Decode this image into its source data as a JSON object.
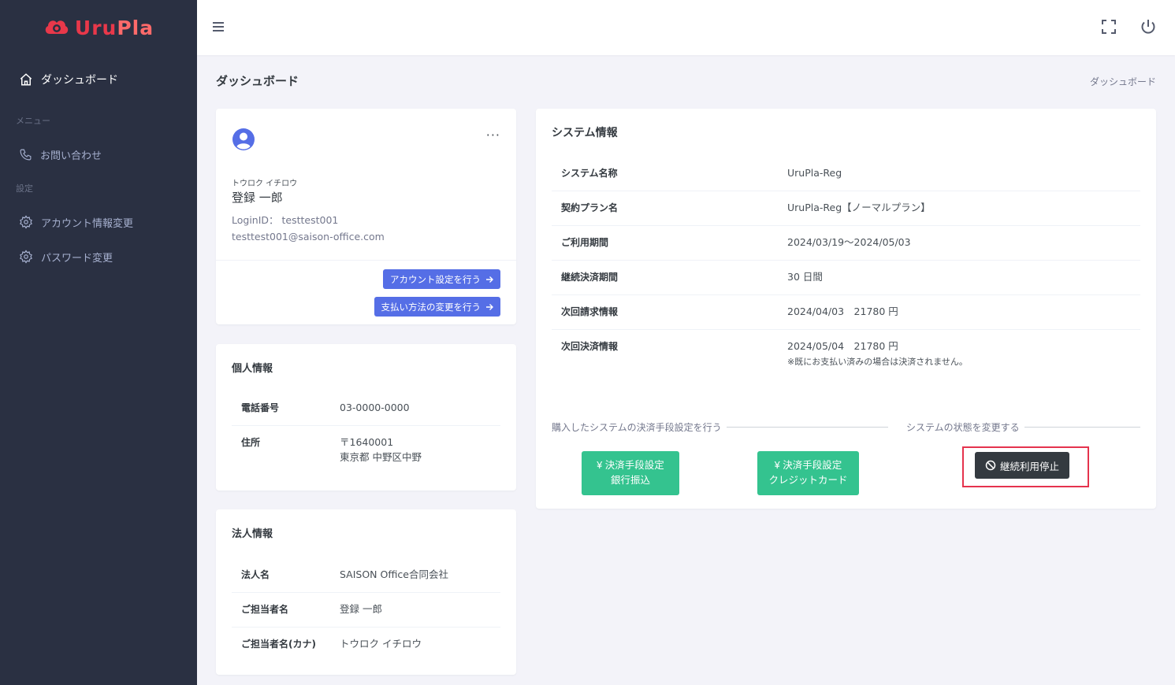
{
  "app": {
    "logo_main": "Uru",
    "logo_accent": "Pla"
  },
  "sidebar": {
    "dashboard": "ダッシュボード",
    "section_menu": "メニュー",
    "contact": "お問い合わせ",
    "section_settings": "設定",
    "account_change": "アカウント情報変更",
    "password_change": "パスワード変更"
  },
  "page": {
    "title": "ダッシュボード",
    "breadcrumb": "ダッシュボード"
  },
  "profile": {
    "name_kana": "トウロク イチロウ",
    "name": "登録 一郎",
    "login_id": "LoginID： testtest001",
    "email": "testtest001@saison-office.com",
    "btn_account": "アカウント設定を行う",
    "btn_payment": "支払い方法の変更を行う"
  },
  "personal": {
    "title": "個人情報",
    "phone_label": "電話番号",
    "phone": "03-0000-0000",
    "address_label": "住所",
    "postal": "〒1640001",
    "address": "東京都 中野区中野"
  },
  "corporate": {
    "title": "法人情報",
    "name_label": "法人名",
    "name": "SAISON Office合同会社",
    "contact_label": "ご担当者名",
    "contact": "登録 一郎",
    "contact_kana_label": "ご担当者名(カナ)",
    "contact_kana": "トウロク イチロウ"
  },
  "system": {
    "title": "システム情報",
    "rows": [
      {
        "label": "システム名称",
        "value": "UruPla-Reg"
      },
      {
        "label": "契約プラン名",
        "value": "UruPla-Reg【ノーマルプラン】"
      },
      {
        "label": "ご利用期間",
        "value": "2024/03/19～2024/05/03"
      },
      {
        "label": "継続決済期間",
        "value": "30 日間"
      },
      {
        "label": "次回請求情報",
        "value": "2024/04/03　21780 円"
      },
      {
        "label": "次回決済情報",
        "value": "2024/05/04　21780 円",
        "note": "※既にお支払い済みの場合は決済されません。"
      }
    ],
    "section_payment": "購入したシステムの決済手段設定を行う",
    "section_status": "システムの状態を変更する",
    "btn_bank_line1": "決済手段設定",
    "btn_bank_line2": "銀行振込",
    "btn_card_line1": "決済手段設定",
    "btn_card_line2": "クレジットカード",
    "btn_stop": "継続利用停止",
    "yen": "¥"
  },
  "colors": {
    "sidebar": "#2a3042",
    "primary": "#556ee6",
    "success": "#34c38f",
    "dark": "#343a40",
    "highlight": "#e5334d",
    "logo": "#e8384a"
  }
}
